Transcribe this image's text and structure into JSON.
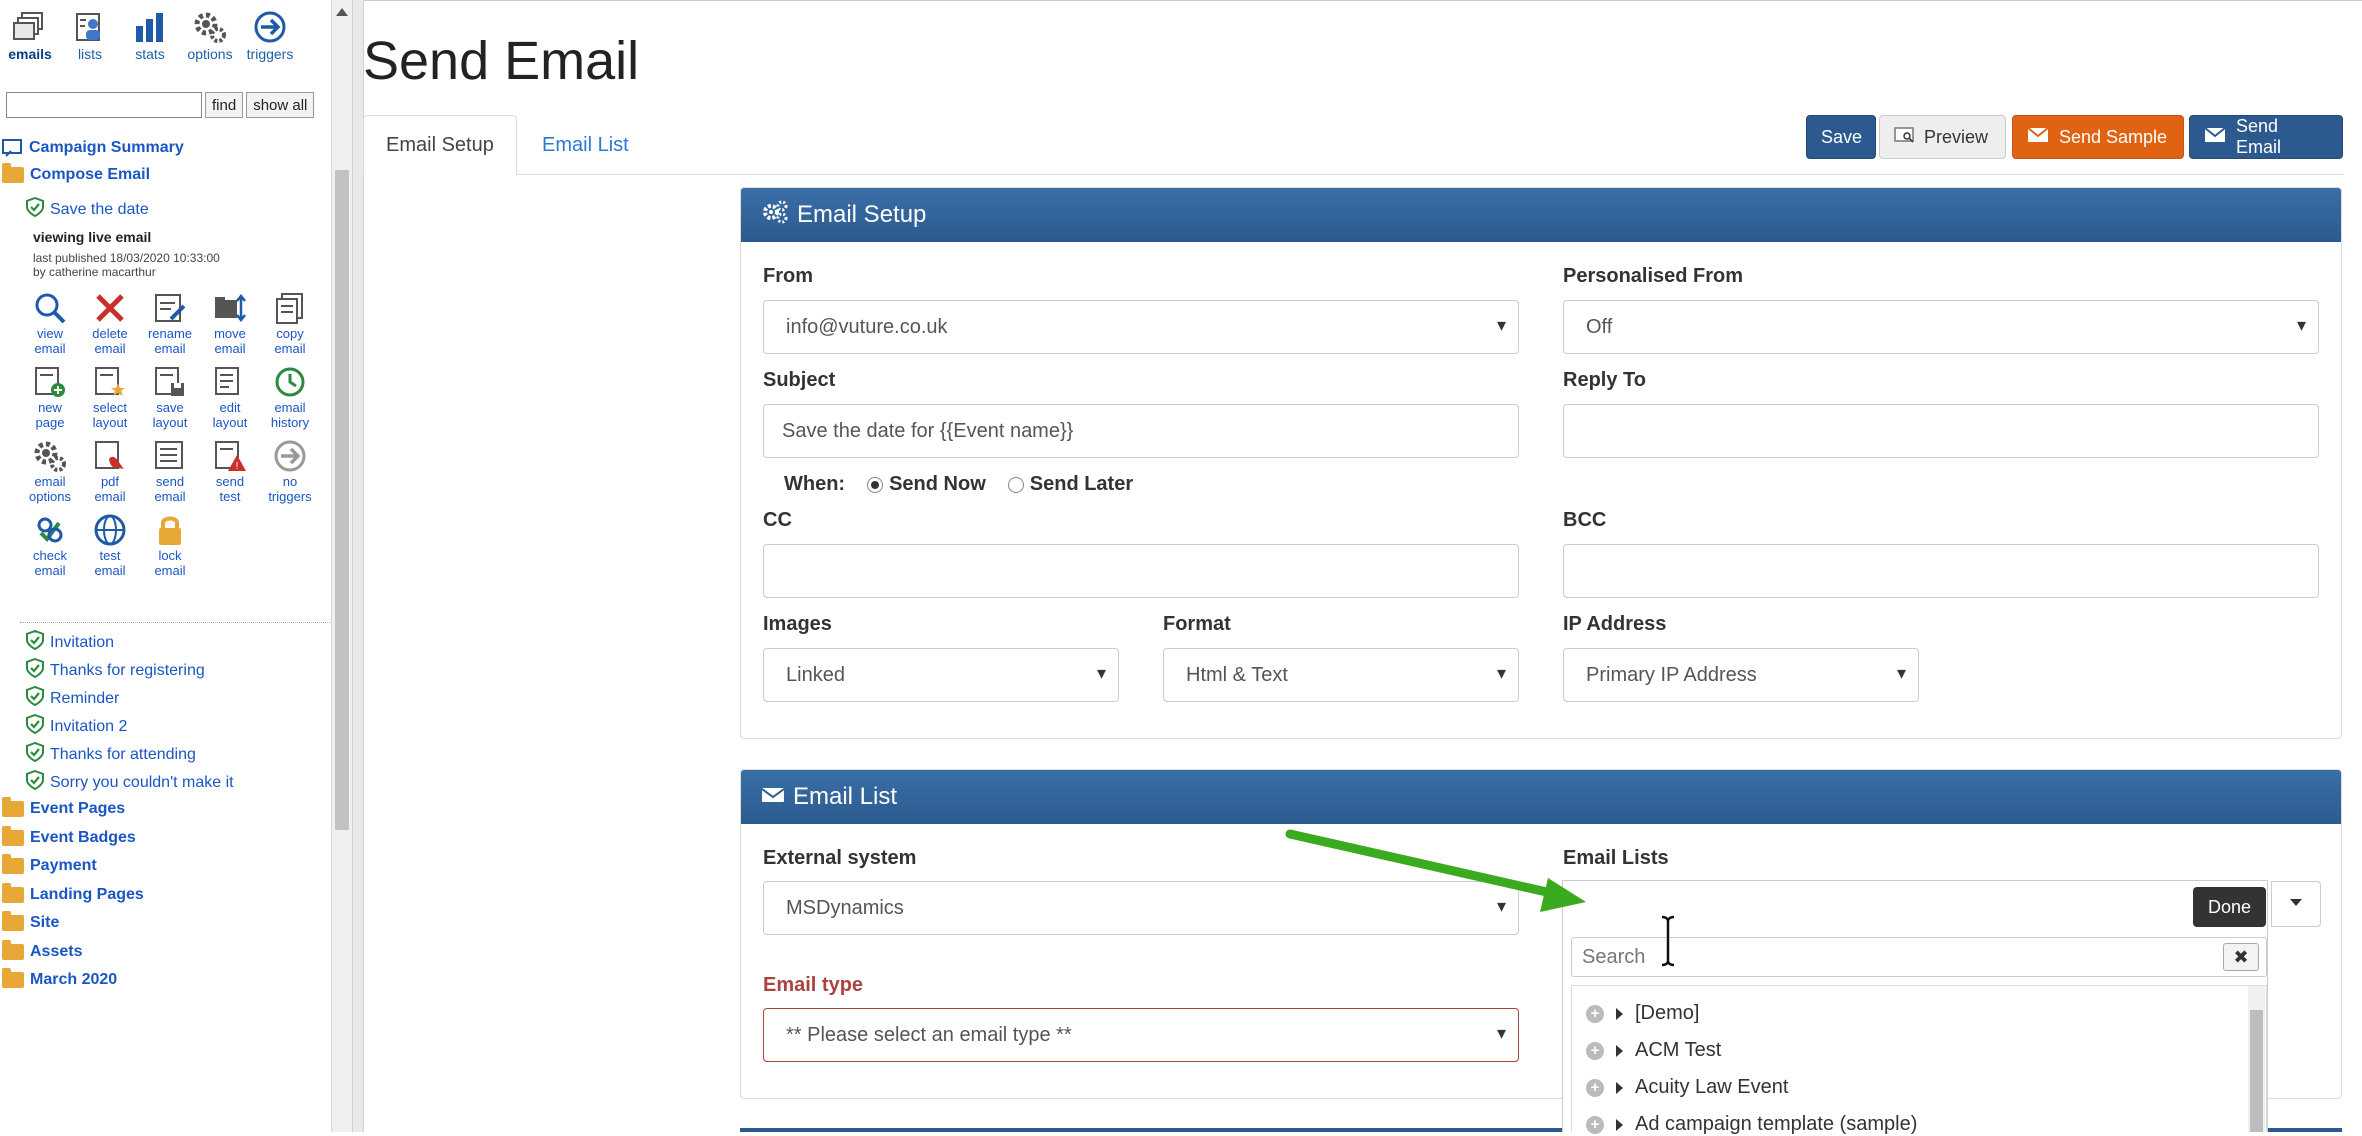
{
  "sidebar": {
    "top_icons": [
      {
        "label": "emails",
        "icon": "emails-icon",
        "active": true
      },
      {
        "label": "lists",
        "icon": "lists-icon"
      },
      {
        "label": "stats",
        "icon": "stats-icon"
      },
      {
        "label": "options",
        "icon": "options-gear-icon"
      },
      {
        "label": "triggers",
        "icon": "triggers-arrow-icon"
      }
    ],
    "find_label": "find",
    "show_all_label": "show all",
    "campaign_summary": "Campaign Summary",
    "compose_email": "Compose Email",
    "current_email": "Save the date",
    "viewing": "viewing  live  email",
    "published_line1": "last published 18/03/2020 10:33:00",
    "published_line2": "by catherine macarthur",
    "actions": [
      {
        "l1": "view",
        "l2": "email"
      },
      {
        "l1": "delete",
        "l2": "email"
      },
      {
        "l1": "rename",
        "l2": "email"
      },
      {
        "l1": "move",
        "l2": "email"
      },
      {
        "l1": "copy",
        "l2": "email"
      },
      {
        "l1": "new",
        "l2": "page"
      },
      {
        "l1": "select",
        "l2": "layout"
      },
      {
        "l1": "save",
        "l2": "layout"
      },
      {
        "l1": "edit",
        "l2": "layout"
      },
      {
        "l1": "email",
        "l2": "history"
      },
      {
        "l1": "email",
        "l2": "options"
      },
      {
        "l1": "pdf",
        "l2": "email"
      },
      {
        "l1": "send",
        "l2": "email"
      },
      {
        "l1": "send",
        "l2": "test"
      },
      {
        "l1": "no",
        "l2": "triggers"
      },
      {
        "l1": "check",
        "l2": "email"
      },
      {
        "l1": "test",
        "l2": "email"
      },
      {
        "l1": "lock",
        "l2": "email"
      }
    ],
    "emails": [
      "Invitation",
      "Thanks for registering",
      "Reminder",
      "Invitation 2",
      "Thanks for attending",
      "Sorry you couldn't make it"
    ],
    "folders": [
      "Event Pages",
      "Event Badges",
      "Payment",
      "Landing Pages",
      "Site",
      "Assets",
      "March 2020"
    ]
  },
  "page": {
    "title": "Send Email",
    "tabs": [
      "Email Setup",
      "Email List"
    ],
    "buttons": {
      "save": "Save",
      "preview": "Preview",
      "send_sample": "Send Sample",
      "send_email": "Send Email"
    }
  },
  "setup": {
    "heading": "Email Setup",
    "from_label": "From",
    "from_value": "info@vuture.co.uk",
    "personalised_label": "Personalised From",
    "personalised_value": "Off",
    "subject_label": "Subject",
    "subject_value": "Save the date for {{Event name}}",
    "reply_label": "Reply To",
    "reply_value": "",
    "when_label": "When:",
    "send_now": "Send Now",
    "send_later": "Send Later",
    "cc_label": "CC",
    "bcc_label": "BCC",
    "images_label": "Images",
    "images_value": "Linked",
    "format_label": "Format",
    "format_value": "Html & Text",
    "ip_label": "IP Address",
    "ip_value": "Primary IP Address"
  },
  "list": {
    "heading": "Email List",
    "external_label": "External system",
    "external_value": "MSDynamics",
    "lists_label": "Email Lists",
    "type_label": "Email type",
    "type_value": "** Please select an email type **",
    "done": "Done",
    "search_placeholder": "Search",
    "items": [
      "[Demo]",
      "ACM Test",
      "Acuity Law Event",
      "Ad campaign template (sample)"
    ]
  },
  "colors": {
    "header": "#2b5a8e",
    "orange": "#e06314",
    "arrow": "#3aaa1f",
    "link": "#1a56c4"
  }
}
